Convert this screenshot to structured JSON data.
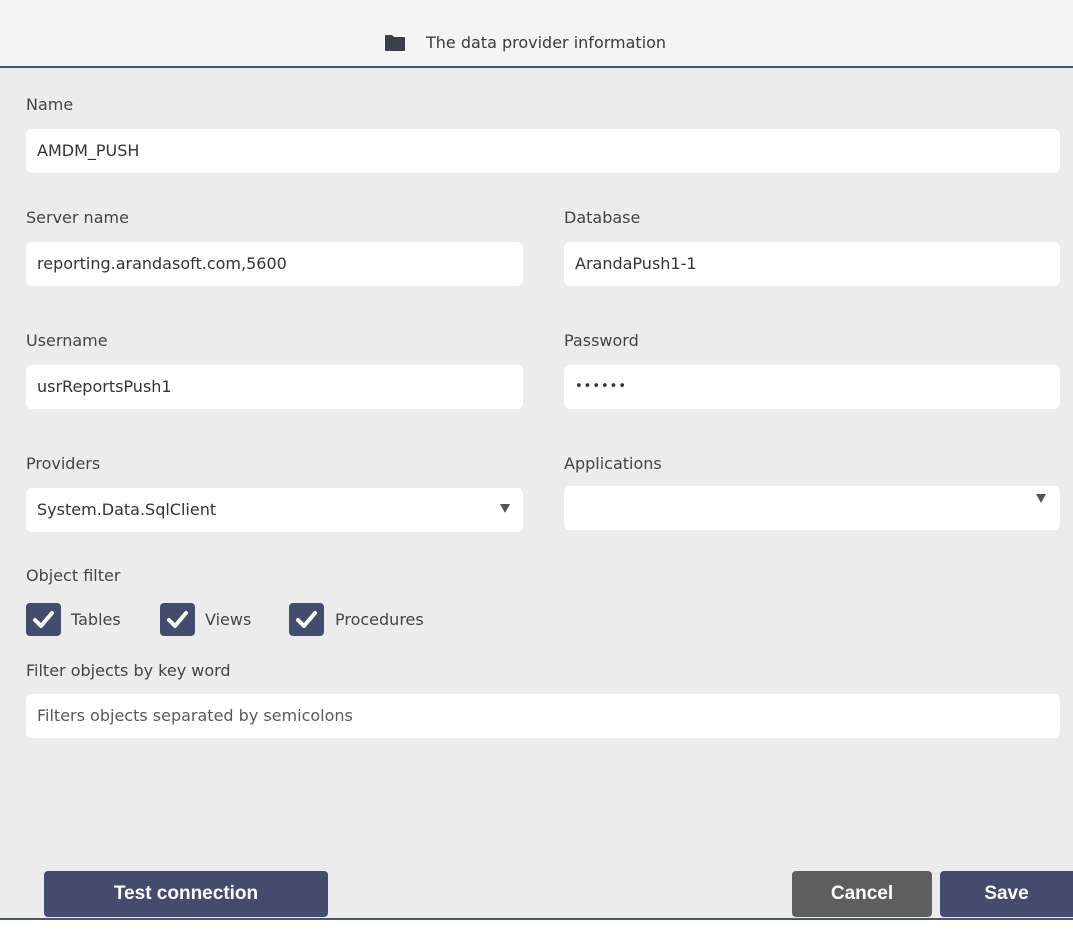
{
  "header": {
    "icon": "folder-icon",
    "title": "The data provider information"
  },
  "form": {
    "name": {
      "label": "Name",
      "value": "AMDM_PUSH"
    },
    "server_name": {
      "label": "Server name",
      "value": "reporting.arandasoft.com,5600"
    },
    "database": {
      "label": "Database",
      "value": "ArandaPush1-1"
    },
    "username": {
      "label": "Username",
      "value": "usrReportsPush1"
    },
    "password": {
      "label": "Password",
      "value": "••••••"
    },
    "providers": {
      "label": "Providers",
      "value": "System.Data.SqlClient"
    },
    "applications": {
      "label": "Applications",
      "value": ""
    },
    "object_filter": {
      "label": "Object filter",
      "options": [
        {
          "label": "Tables",
          "checked": true
        },
        {
          "label": "Views",
          "checked": true
        },
        {
          "label": "Procedures",
          "checked": true
        }
      ]
    },
    "keyword_filter": {
      "label": "Filter objects by key word",
      "placeholder": "Filters objects separated by semicolons"
    }
  },
  "buttons": {
    "test_connection": "Test connection",
    "cancel": "Cancel",
    "save": "Save"
  },
  "colors": {
    "primary": "#434c6c",
    "secondary": "#5e5e5e",
    "background": "#ececec"
  }
}
